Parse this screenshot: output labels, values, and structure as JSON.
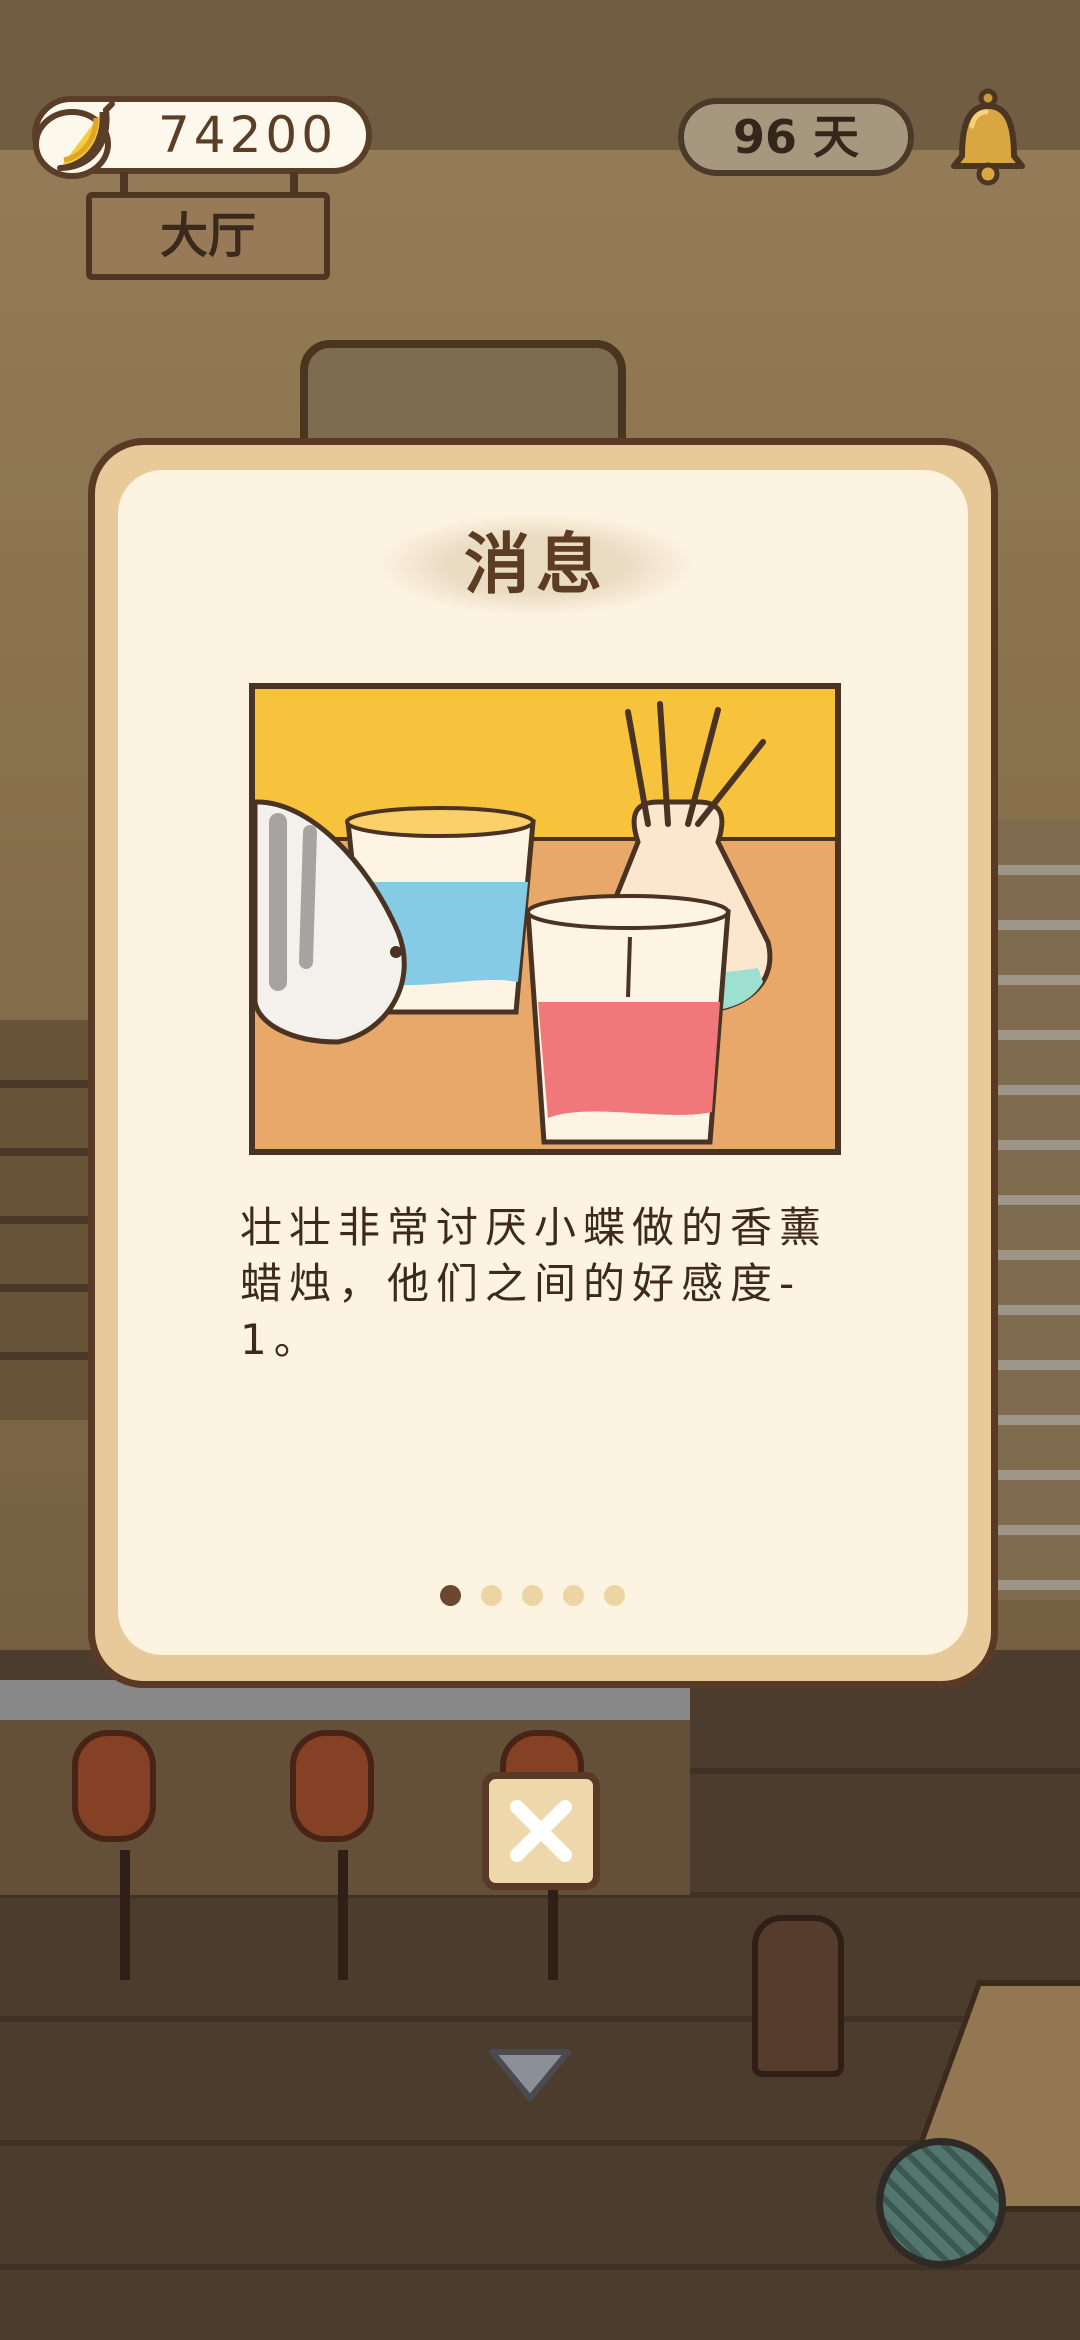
{
  "hud": {
    "currency_icon": "banana-icon",
    "currency_value": "74200",
    "room_name": "大厅",
    "days_label": "96 天",
    "notification_icon": "bell-icon"
  },
  "dialog": {
    "title": "消息",
    "illustration_icon": "cat-paw-holding-candles-illustration",
    "message": "壮壮非常讨厌小蝶做的香薰蜡烛，他们之间的好感度-1。",
    "page_count": 5,
    "current_page": 1,
    "close_icon": "close-icon"
  },
  "footer": {
    "collapse_icon": "chevron-down-icon",
    "yarn_icon": "yarn-ball-icon"
  },
  "colors": {
    "dialog_border": "#5a3a24",
    "dialog_frame": "#e7c99a",
    "dialog_paper": "#fdf3e1",
    "dot_active": "#6b4830",
    "dot_inactive": "#ecd5a3"
  }
}
